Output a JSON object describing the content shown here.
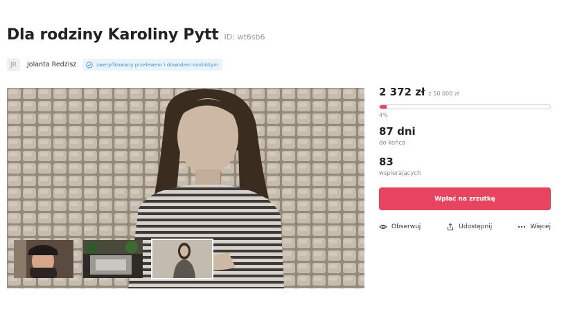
{
  "campaign": {
    "title": "Dla rodziny Karoliny Pytt",
    "id_label": "ID: wt6sb6"
  },
  "author": {
    "initials": "JR",
    "name": "Jolanta Redzisz",
    "verified_text": "zweryfikowany przelewem i dowodem osobistym"
  },
  "gallery": {
    "thumbnail_count": 3,
    "active_index": 2
  },
  "stats": {
    "raised": "2 372 zł",
    "goal": "z 50 000 zł",
    "progress_percent": 4,
    "progress_label": "4%",
    "days_value": "87 dni",
    "days_label": "do końca",
    "supporters_value": "83",
    "supporters_label": "wspierających"
  },
  "actions": {
    "pay_label": "Wpłać na zrzutkę",
    "observe_label": "Obserwuj",
    "share_label": "Udostępnij",
    "more_label": "Więcej",
    "observe_icon": "eye-icon",
    "share_icon": "share-icon",
    "more_icon": "more-dots-icon"
  },
  "colors": {
    "accent": "#e8445f",
    "verified_bg": "#e9f3fb",
    "verified_text": "#4a8fc4"
  }
}
